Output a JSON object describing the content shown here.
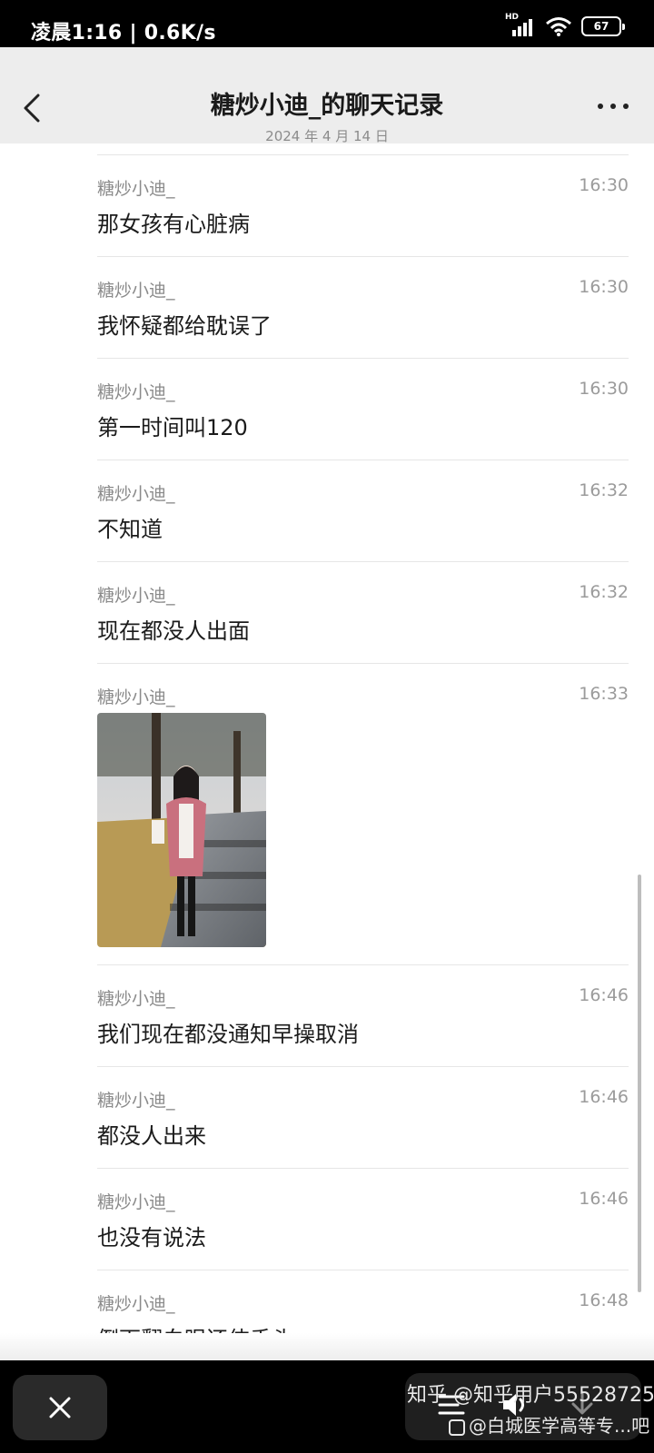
{
  "status_bar": {
    "time_speed": "凌晨1:16 | 0.6K/s",
    "hd": "HD",
    "battery": "67"
  },
  "header": {
    "title": "糖炒小迪_的聊天记录",
    "date": "2024 年 4 月 14 日"
  },
  "messages": [
    {
      "sender": "糖炒小迪_",
      "time": "16:30",
      "text": "那女孩有心脏病"
    },
    {
      "sender": "糖炒小迪_",
      "time": "16:30",
      "text": "我怀疑都给耽误了"
    },
    {
      "sender": "糖炒小迪_",
      "time": "16:30",
      "text": "第一时间叫120"
    },
    {
      "sender": "糖炒小迪_",
      "time": "16:32",
      "text": "不知道"
    },
    {
      "sender": "糖炒小迪_",
      "time": "16:32",
      "text": "现在都没人出面"
    },
    {
      "sender": "糖炒小迪_",
      "time": "16:33",
      "text": ""
    },
    {
      "sender": "糖炒小迪_",
      "time": "16:46",
      "text": "我们现在都没通知早操取消"
    },
    {
      "sender": "糖炒小迪_",
      "time": "16:46",
      "text": "都没人出来"
    },
    {
      "sender": "糖炒小迪_",
      "time": "16:46",
      "text": "也没有说法"
    },
    {
      "sender": "糖炒小迪_",
      "time": "16:48",
      "text": "倒下翻白眼还伸舌头"
    }
  ],
  "watermark": {
    "line1": "知乎 @知乎用户55528725",
    "line2": "@白城医学高等专...吧"
  },
  "icons": {
    "back": "chevron-left-icon",
    "more": "more-dots-icon",
    "close": "close-icon",
    "menu": "list-icon",
    "volume": "volume-icon",
    "download": "download-icon"
  },
  "colors": {
    "header_bg": "#ededed",
    "chat_bg": "#ffffff",
    "sender": "#8a8a8a",
    "text": "#1b1b1b"
  }
}
